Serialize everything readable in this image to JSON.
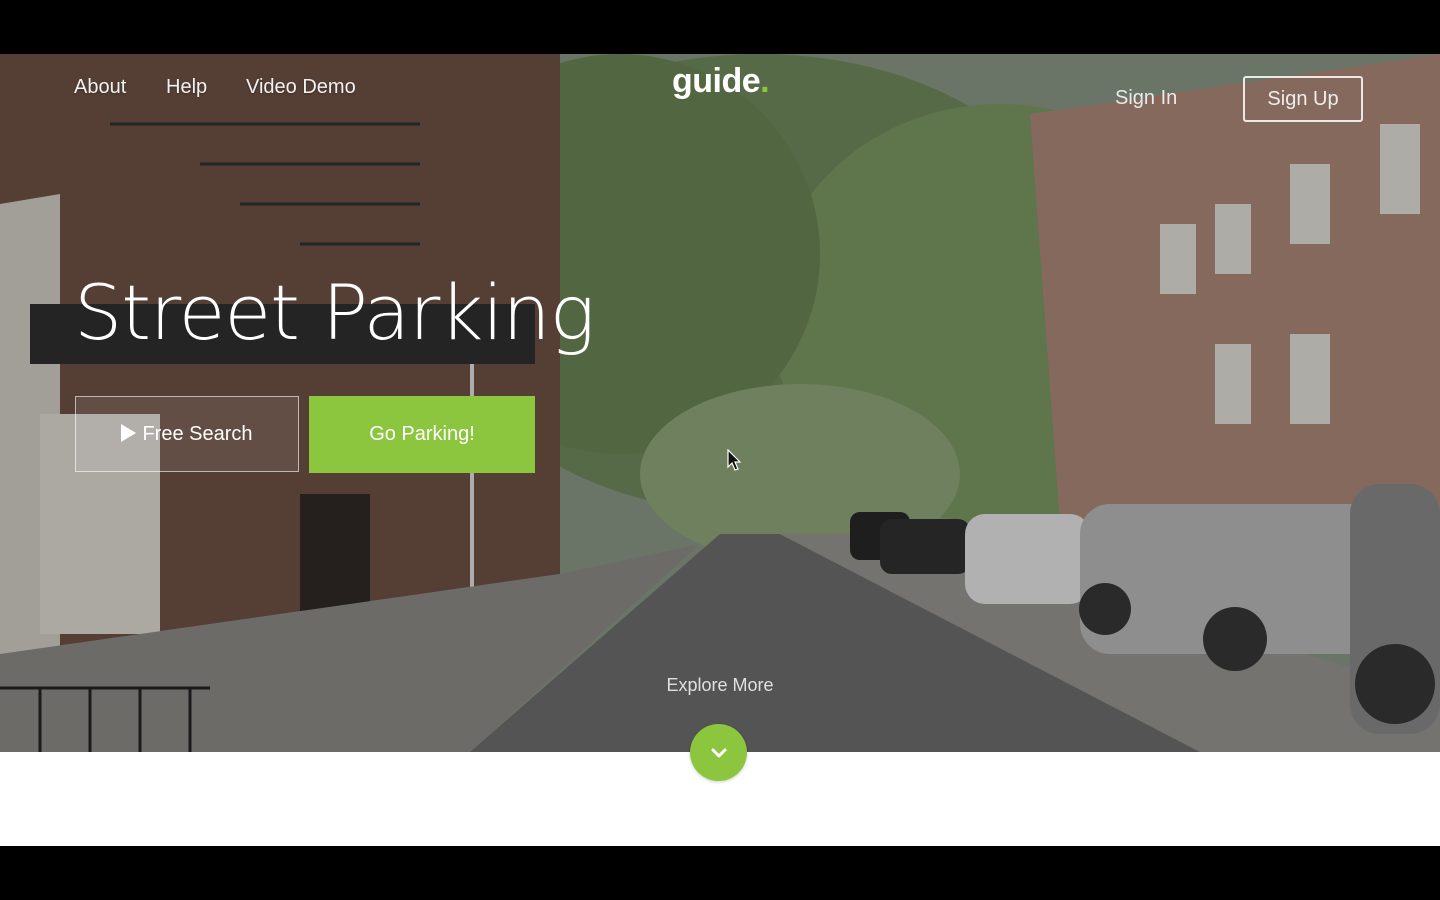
{
  "nav": {
    "left_links": [
      "About",
      "Help",
      "Video Demo"
    ],
    "logo_text": "guide",
    "logo_dot": ".",
    "sign_in": "Sign In",
    "sign_up": "Sign Up"
  },
  "hero": {
    "headline": "Street Parking",
    "free_search_label": "Free Search",
    "go_parking_label": "Go Parking!",
    "explore_label": "Explore More"
  },
  "colors": {
    "accent_green": "#8cc63f",
    "text_light": "#ffffff"
  },
  "icons": {
    "play": "play-icon",
    "chevron": "chevron-down-icon",
    "cursor": "mouse-pointer-icon"
  }
}
